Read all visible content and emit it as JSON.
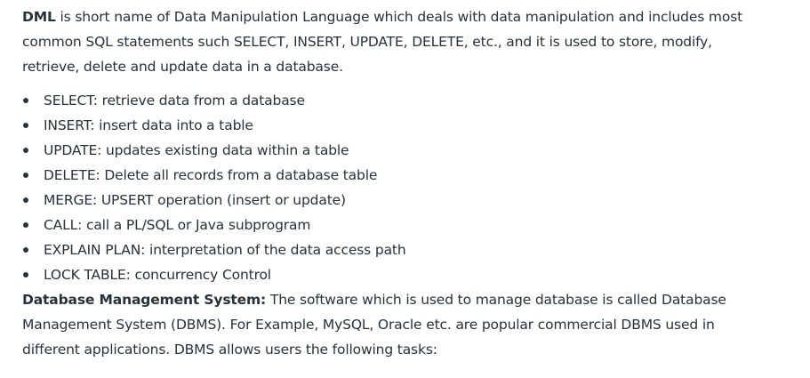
{
  "intro": {
    "term": "DML",
    "text": " is short name of Data Manipulation Language which deals with data manipulation and includes most common SQL statements such SELECT, INSERT, UPDATE, DELETE, etc., and it is used to store, modify, retrieve, delete and update data in a database."
  },
  "commands": [
    "SELECT: retrieve data from a database",
    "INSERT: insert data into a table",
    "UPDATE: updates existing data within a table",
    "DELETE: Delete all records from a database table",
    "MERGE: UPSERT operation (insert or update)",
    "CALL: call a PL/SQL or Java subprogram",
    "EXPLAIN PLAN: interpretation of the data access path",
    "LOCK TABLE: concurrency Control"
  ],
  "dbms": {
    "term": "Database Management System:",
    "text": " The software which is used to manage database is called Database Management System (DBMS). For Example, MySQL, Oracle etc. are popular commercial DBMS used in different applications. DBMS allows users the following tasks:"
  }
}
